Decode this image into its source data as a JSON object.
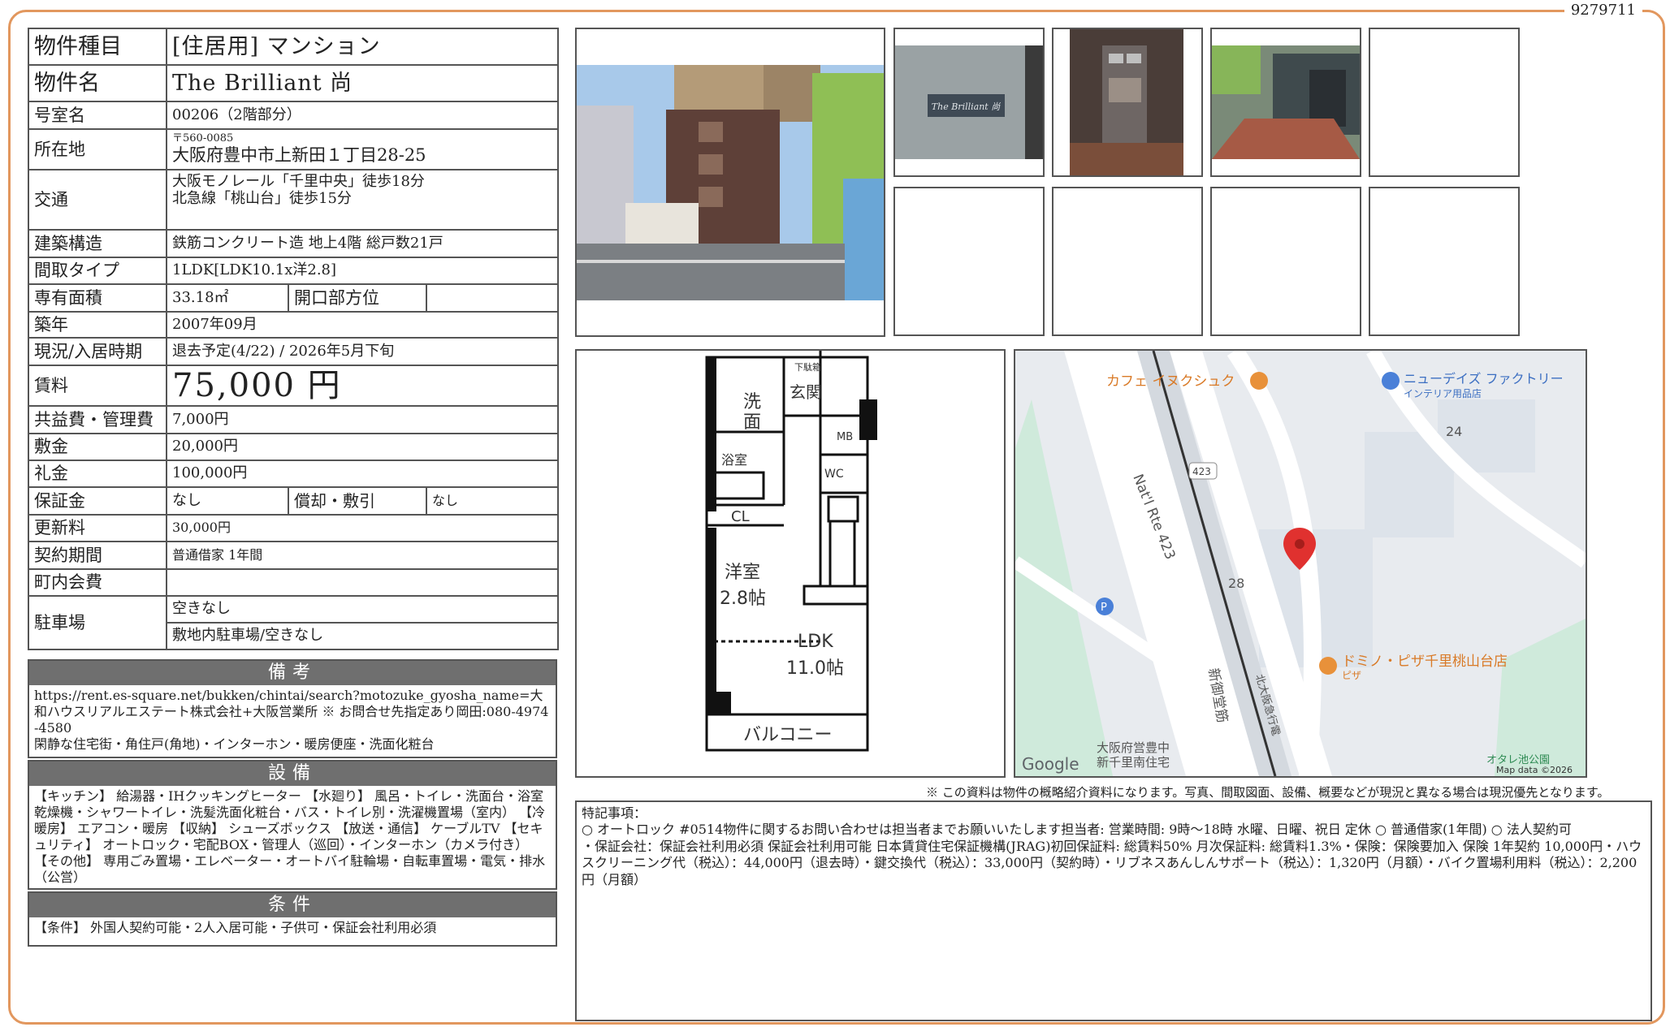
{
  "doc_id": "9279711",
  "spec": {
    "type_label": "物件種目",
    "type_value": "[住居用] マンション",
    "name_label": "物件名",
    "name_value": "The Brilliant 尚",
    "room_label": "号室名",
    "room_value": "00206（2階部分）",
    "address_label": "所在地",
    "zip": "〒560-0085",
    "address": "大阪府豊中市上新田１丁目28-25",
    "access_label": "交通",
    "access_1": "大阪モノレール「千里中央」徒歩18分",
    "access_2": "北急線「桃山台」徒歩15分",
    "structure_label": "建築構造",
    "structure_value": "鉄筋コンクリート造 地上4階 総戸数21戸",
    "layout_label": "間取タイプ",
    "layout_value": "1LDK[LDK10.1x洋2.8]",
    "area_label": "専有面積",
    "area_value": "33.18㎡",
    "opening_label": "開口部方位",
    "opening_value": "",
    "built_label": "築年",
    "built_value": "2007年09月",
    "status_label": "現況/入居時期",
    "status_value": "退去予定(4/22) / 2026年5月下旬",
    "rent_label": "賃料",
    "rent_value": "75,000 円",
    "fee_label": "共益費・管理費",
    "fee_value": "7,000円",
    "deposit_label": "敷金",
    "deposit_value": "20,000円",
    "key_money_label": "礼金",
    "key_money_value": "100,000円",
    "guarantee_label": "保証金",
    "guarantee_value": "なし",
    "amort_label": "償却・敷引",
    "amort_value": "なし",
    "renewal_label": "更新料",
    "renewal_value": "30,000円",
    "contract_label": "契約期間",
    "contract_value": "普通借家 1年間",
    "community_label": "町内会費",
    "community_value": "",
    "parking_label": "駐車場",
    "parking_1": "空きなし",
    "parking_2": "敷地内駐車場/空きなし"
  },
  "remarks": {
    "header": "備考",
    "url": "https://rent.es-square.net/bukken/chintai/search?motozuke_gyosha_name=大和ハウスリアルエステート株式会社+大阪営業所 ※ お問合せ先指定あり岡田:080-4974-4580",
    "text": "閑静な住宅街・角住戸(角地)・インターホン・暖房便座・洗面化粧台"
  },
  "facilities": {
    "header": "設備",
    "text": "【キッチン】 給湯器・IHクッキングヒーター 【水廻り】 風呂・トイレ・洗面台・浴室乾燥機・シャワートイレ・洗髪洗面化粧台・バス・トイレ別・洗濯機置場（室内） 【冷暖房】 エアコン・暖房 【収納】 シューズボックス 【放送・通信】 ケーブルTV 【セキュリティ】 オートロック・宅配BOX・管理人（巡回）・インターホン（カメラ付き） 【その他】 専用ごみ置場・エレベーター・オートバイ駐輪場・自転車置場・電気・排水（公営）"
  },
  "conditions": {
    "header": "条件",
    "text": "【条件】 外国人契約可能・2人入居可能・子供可・保証会社利用必須"
  },
  "photo_labels": {
    "sign": "The Brilliant 尚"
  },
  "floorplan": {
    "shoe": "下駄箱",
    "wash_1": "洗",
    "wash_2": "面",
    "entry": "玄関",
    "mb": "MB",
    "bath": "浴室",
    "wc": "WC",
    "cl": "CL",
    "western_1": "洋室",
    "western_2": "2.8帖",
    "ldk_1": "LDK",
    "ldk_2": "11.0帖",
    "balcony": "バルコニー"
  },
  "map": {
    "cafe": "カフェ イヌクシュク",
    "store": "ニューデイズ ファクトリー",
    "store_sub": "インテリア用品店",
    "n24": "24",
    "n28": "28",
    "route_badge": "423",
    "route": "Nat'l Rte 423",
    "pizza": "ドミノ・ピザ千里桃山台店",
    "pizza_sub": "ピザ",
    "road_1": "新御堂筋",
    "road_2": "北大阪急行電",
    "housing_1": "大阪府営豊中",
    "housing_2": "新千里南住宅",
    "park": "オタレ池公園",
    "google": "Google",
    "mapdata": "Map data ©2026",
    "colors": {
      "road": "#ffffff",
      "block": "#dde3ea",
      "green": "#cfeadb",
      "pin": "#e0312f",
      "poi": "#e8913a",
      "blue": "#4a80d8"
    }
  },
  "disclaimer": "※ この資料は物件の概略紹介資料になります。写真、間取図面、設備、概要などが現況と異なる場合は現況優先となります。",
  "notes": {
    "title": "特記事項：",
    "line1": "○ オートロック #0514物件に関するお問い合わせは担当者までお願いいたします担当者: 営業時間: 9時～18時 水曜、日曜、祝日 定休 ○ 普通借家(1年間) ○ 法人契約可",
    "line2": "・保証会社：保証会社利用必須 保証会社利用可能 日本賃貸住宅保証機構(JRAG)初回保証料: 総賃料50% 月次保証料: 総賃料1.3%・保険：保険要加入 保険 1年契約 10,000円・ハウスクリーニング代（税込）：44,000円（退去時）・鍵交換代（税込）：33,000円（契約時）・リブネスあんしんサポート（税込）：1,320円（月額）・バイク置場利用料（税込）：2,200円（月額）"
  },
  "frame_color": "#e2975e"
}
